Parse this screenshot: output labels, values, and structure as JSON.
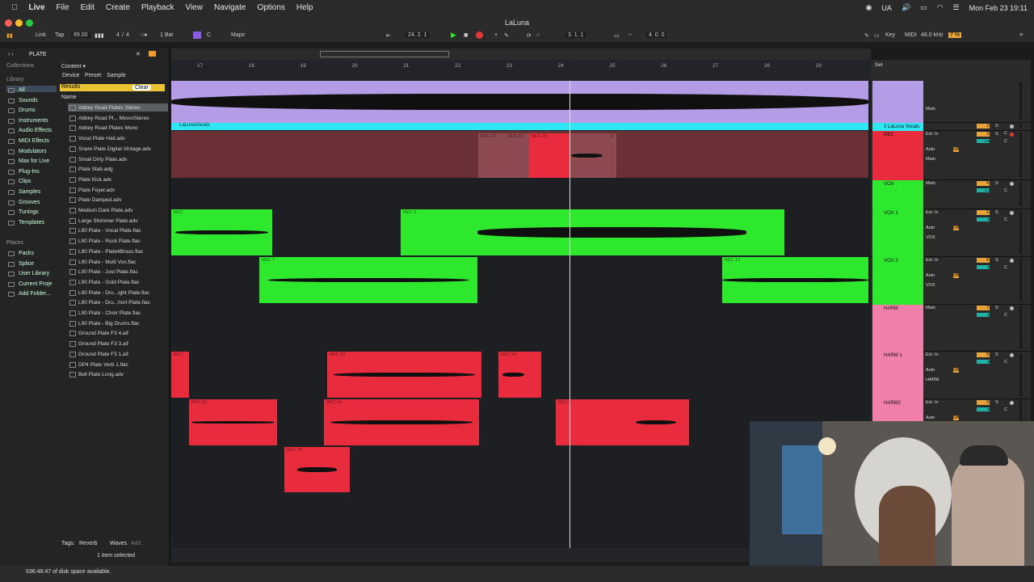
{
  "menubar": {
    "app": "Live",
    "items": [
      "File",
      "Edit",
      "Create",
      "Playback",
      "View",
      "Navigate",
      "Options",
      "Help"
    ],
    "lang": "UA",
    "datetime": "Mon Feb 23  19:11"
  },
  "window": {
    "title": "LaLuna"
  },
  "toolbar": {
    "link": "Link",
    "tap": "Tap",
    "tempo": "89.00",
    "sig_num": "4",
    "sig_den": "4",
    "quant": "1 Bar",
    "key": "C",
    "scale": "Major",
    "position": "24.  2.  1",
    "loop_start": "3.  1.  1",
    "loop_len": "4.  0.  0",
    "key_label": "Key",
    "midi_label": "MIDI",
    "sample_rate": "48.0 kHz",
    "cpu": "7 %"
  },
  "browser": {
    "search": "PLATE",
    "collections_label": "Collections",
    "library_label": "Library",
    "places_label": "Places",
    "content_label": "Content ▾",
    "filters": [
      "Device",
      "Preset",
      "Sample"
    ],
    "results_label": "Results",
    "clear_label": "Clear",
    "name_header": "Name",
    "library": [
      "All",
      "Sounds",
      "Drums",
      "Instruments",
      "Audio Effects",
      "MIDI Effects",
      "Modulators",
      "Max for Live",
      "Plug-Ins",
      "Clips",
      "Samples",
      "Grooves",
      "Tunings",
      "Templates"
    ],
    "places": [
      "Packs",
      "Splice",
      "User Library",
      "Current Proje",
      "Add Folder..."
    ],
    "results": [
      "Abbey Road Plates Stereo",
      "Abbey Road Pl... Mono/Stereo",
      "Abbey Road Plates Mono",
      "Vocal Plate Hall.adv",
      "Snare Plate Digital Vintage.adv",
      "Small Dirty Plate.adv",
      "Plate Stab.adg",
      "Plate Kick.adv",
      "Plate Foyer.adv",
      "Plate Damped.adv",
      "Medium Dark Plate.adv",
      "Large Shimmer Plate.adv",
      "L90 Plate - Vocal Plate.flac",
      "L90 Plate - Rock Plate.flac",
      "L90 Plate - Plate4Brass.flac",
      "L90 Plate - Multi Vox.flac",
      "L90 Plate - Just Plate.flac",
      "L90 Plate - Gold Plate.flac",
      "L90 Plate - Dru...ight Plate.flac",
      "L90 Plate - Dru...hort Plate.flac",
      "L90 Plate - Choir Plate.flac",
      "L90 Plate - Big Drums.flac",
      "Ground Plate F3 4.aif",
      "Ground Plate F3 3.aif",
      "Ground Plate F3 1.aif",
      "DP4 Plate Verb 1.flac",
      "Bell Plate Long.adv"
    ],
    "tags_label": "Tags:",
    "tags": [
      "Reverb",
      "Waves"
    ],
    "tag_add": "Add...",
    "selection": "1 item selected"
  },
  "arrangement": {
    "bars": [
      "17",
      "18",
      "19",
      "20",
      "21",
      "22",
      "23",
      "24",
      "25",
      "26",
      "27",
      "28",
      "29"
    ],
    "set_label": "Set",
    "times": [
      "0:45",
      "0:50",
      "0:55",
      "1:00",
      "1:05",
      "1:10"
    ],
    "lead_label": "LaLunaVocals",
    "clips": {
      "rec_dim": [
        "REC 42",
        "REC 42",
        "REC 43",
        "R"
      ],
      "vox1": [
        "REC",
        "REC 5"
      ],
      "vox2": [
        "REC 7",
        "REC 13"
      ],
      "harm1": [
        "REC",
        "REC 23",
        "REC 24"
      ],
      "harm2": [
        "REC 36",
        "REC 34",
        "REC 6"
      ],
      "harm3": [
        "REC 29"
      ]
    }
  },
  "mixer": {
    "tracks": [
      {
        "name": "",
        "num": "",
        "input": "",
        "monitor": "Main",
        "color": "#b49ce6"
      },
      {
        "name": "2 LaLuna Vocals",
        "num": "2",
        "input": "",
        "monitor": "",
        "color": "#2fe7f2"
      },
      {
        "name": "REC",
        "num": "3",
        "input": "Ext. In",
        "monitor": "Main",
        "color": "#e82c3d",
        "vol": "-1.6"
      },
      {
        "name": "VOX",
        "num": "4",
        "input": "Main",
        "monitor": "",
        "color": "#2ee82e",
        "vol": "-1.4"
      },
      {
        "name": "VOX 1",
        "num": "5",
        "input": "Ext. In",
        "monitor": "VOX",
        "color": "#2ee82e",
        "vol": "0"
      },
      {
        "name": "VOX 2",
        "num": "6",
        "input": "Ext. In",
        "monitor": "VOX",
        "color": "#2ee82e",
        "vol": "0"
      },
      {
        "name": "HARM",
        "num": "7",
        "input": "Main",
        "monitor": "",
        "color": "#f07fa9",
        "vol": "0"
      },
      {
        "name": "HARM 1",
        "num": "8",
        "input": "Ext. In",
        "monitor": "HARM",
        "color": "#f07fa9",
        "vol": "0"
      },
      {
        "name": "HARM2",
        "num": "9",
        "input": "Ext. In",
        "monitor": "",
        "color": "#f07fa9",
        "vol": "0"
      }
    ],
    "auto": "Auto",
    "off": "Off",
    "main": "Main",
    "s": "S",
    "c": "C"
  },
  "status": {
    "disk": "536:48:47 of disk space available."
  }
}
